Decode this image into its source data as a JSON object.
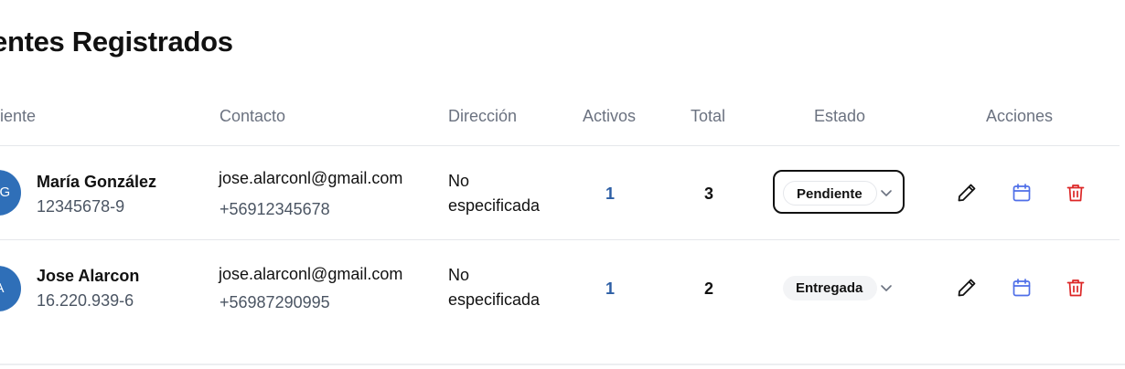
{
  "page": {
    "title": "entes Registrados"
  },
  "table": {
    "headers": {
      "cliente": "iente",
      "contacto": "Contacto",
      "direccion": "Dirección",
      "activos": "Activos",
      "total": "Total",
      "estado": "Estado",
      "acciones": "Acciones"
    },
    "rows": [
      {
        "initials": "MG",
        "name": "María González",
        "rut": "12345678-9",
        "email": "jose.alarconl@gmail.com",
        "phone": "+56912345678",
        "address_line1": "No",
        "address_line2": "especificada",
        "activos": "1",
        "total": "3",
        "estado": "Pendiente"
      },
      {
        "initials": "JA",
        "name": "Jose Alarcon",
        "rut": "16.220.939-6",
        "email": "jose.alarconl@gmail.com",
        "phone": "+56987290995",
        "address_line1": "No",
        "address_line2": "especificada",
        "activos": "1",
        "total": "2",
        "estado": "Entregada"
      }
    ]
  },
  "actions": {
    "edit_icon": "pencil-icon",
    "calendar_icon": "calendar-icon",
    "delete_icon": "trash-icon"
  },
  "colors": {
    "avatar": "#2f6fb8",
    "activos": "#2d5fa5",
    "calendar": "#4f6fe8",
    "delete": "#dc2626"
  }
}
